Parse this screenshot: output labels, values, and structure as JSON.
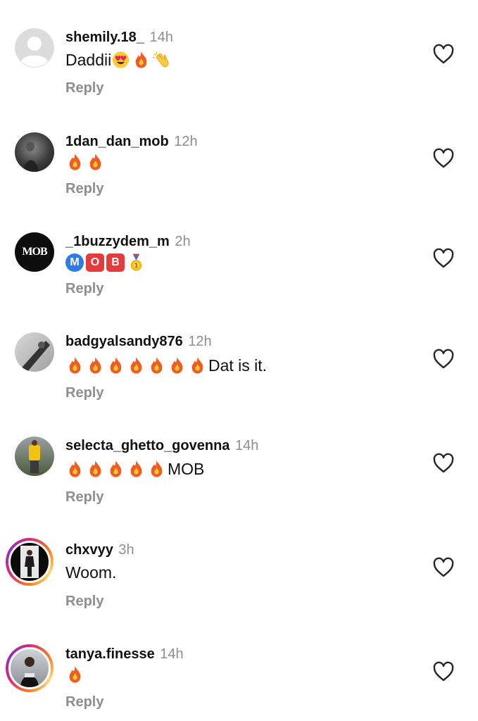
{
  "reply_label": "Reply",
  "comments": [
    {
      "username": "shemily.18_",
      "time": "14h",
      "text": "Daddii",
      "emojis": [
        "heart-eyes-emoji",
        "fire-emoji",
        "clapping-hands-emoji"
      ]
    },
    {
      "username": "1dan_dan_mob",
      "time": "12h",
      "text": "",
      "emojis": [
        "fire-emoji",
        "fire-emoji"
      ]
    },
    {
      "username": "_1buzzydem_m",
      "time": "2h",
      "text": "",
      "emojis": [
        "m-badge-emoji",
        "o-badge-emoji",
        "b-badge-emoji",
        "medal-emoji"
      ],
      "badge_letters": [
        "M",
        "O",
        "B"
      ],
      "avatar_text": "MOB"
    },
    {
      "username": "badgyalsandy876",
      "time": "12h",
      "text": "Dat is it.",
      "emojis": [
        "fire-emoji",
        "fire-emoji",
        "fire-emoji",
        "fire-emoji",
        "fire-emoji",
        "fire-emoji",
        "fire-emoji"
      ]
    },
    {
      "username": "selecta_ghetto_govenna",
      "time": "14h",
      "text": "MOB",
      "emojis": [
        "fire-emoji",
        "fire-emoji",
        "fire-emoji",
        "fire-emoji",
        "fire-emoji"
      ]
    },
    {
      "username": "chxvyy",
      "time": "3h",
      "text": "Woom.",
      "emojis": []
    },
    {
      "username": "tanya.finesse",
      "time": "14h",
      "text": "",
      "emojis": [
        "fire-emoji"
      ]
    }
  ],
  "colors": {
    "username": "#111111",
    "muted": "#8e8e8e",
    "fire": "#f25c1f",
    "story_ring": "#d62976"
  }
}
